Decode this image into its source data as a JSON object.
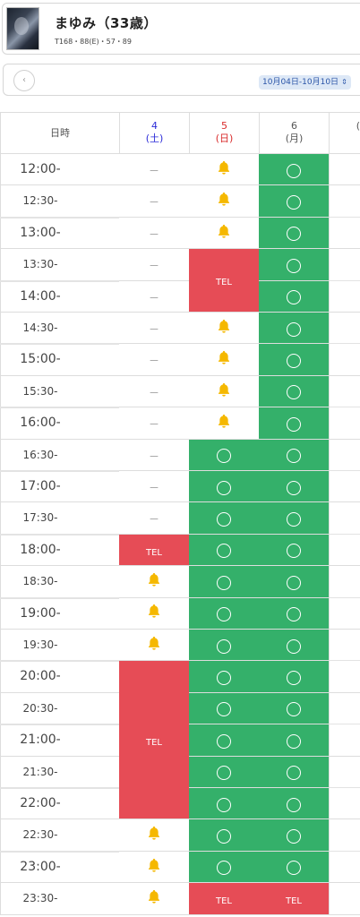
{
  "profile": {
    "name": "まゆみ（33歳）",
    "spec": "T168・88(E)・57・89"
  },
  "week": {
    "prev_label": "‹",
    "range": "10月04日-10月10日"
  },
  "header": {
    "time_label": "日時",
    "days": [
      {
        "date": "4",
        "weekday": "(土)",
        "color": "blue"
      },
      {
        "date": "5",
        "weekday": "(日)",
        "color": "red"
      },
      {
        "date": "6",
        "weekday": "(月)",
        "color": "gray"
      },
      {
        "date": "",
        "weekday": "(",
        "color": "gray"
      }
    ]
  },
  "legend": {
    "dash": "－",
    "tel": "TEL",
    "circle": "available",
    "bell": "bell"
  },
  "colors": {
    "available": "#34b06a",
    "tel": "#e64c56",
    "bell": "#f5b800",
    "sat": "#2b2bd8",
    "sun": "#d92b2b"
  },
  "times": [
    "12:00-",
    "12:30-",
    "13:00-",
    "13:30-",
    "14:00-",
    "14:30-",
    "15:00-",
    "15:30-",
    "16:00-",
    "16:30-",
    "17:00-",
    "17:30-",
    "18:00-",
    "18:30-",
    "19:00-",
    "19:30-",
    "20:00-",
    "20:30-",
    "21:00-",
    "21:30-",
    "22:00-",
    "22:30-",
    "23:00-",
    "23:30-"
  ],
  "slots": {
    "day4": [
      "dash",
      "dash",
      "dash",
      "dash",
      "dash",
      "dash",
      "dash",
      "dash",
      "dash",
      "dash",
      "dash",
      "dash",
      "tel",
      "bell",
      "bell",
      "bell",
      "tel",
      "tel",
      "tel",
      "tel",
      "tel",
      "bell",
      "bell",
      "bell"
    ],
    "day5": [
      "bell",
      "bell",
      "bell",
      "tel",
      "tel",
      "bell",
      "bell",
      "bell",
      "bell",
      "circle",
      "circle",
      "circle",
      "circle",
      "circle",
      "circle",
      "circle",
      "circle",
      "circle",
      "circle",
      "circle",
      "circle",
      "circle",
      "circle",
      "tel"
    ],
    "day6": [
      "circle",
      "circle",
      "circle",
      "circle",
      "circle",
      "circle",
      "circle",
      "circle",
      "circle",
      "circle",
      "circle",
      "circle",
      "circle",
      "circle",
      "circle",
      "circle",
      "circle",
      "circle",
      "circle",
      "circle",
      "circle",
      "circle",
      "circle",
      "tel"
    ]
  }
}
